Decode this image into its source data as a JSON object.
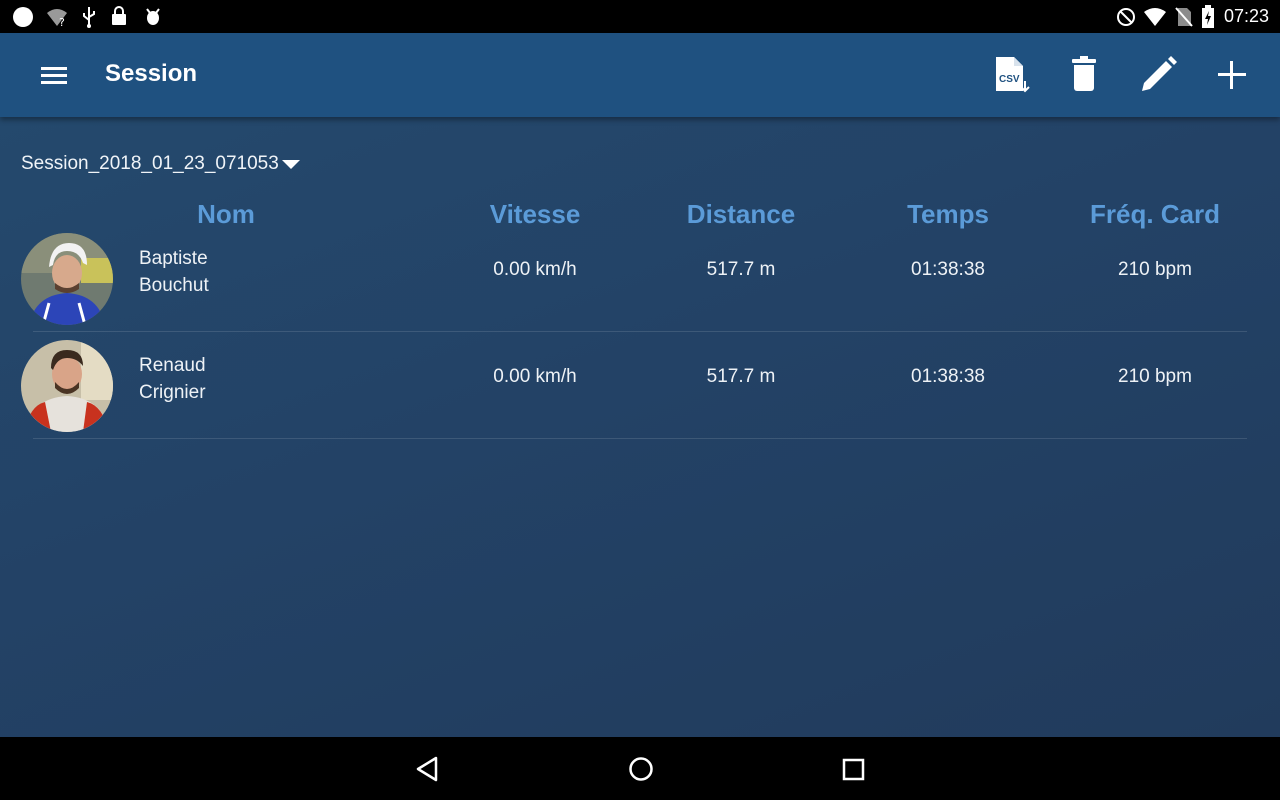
{
  "status_bar": {
    "time": "07:23",
    "left_icons": [
      "circle-icon",
      "wifi-unknown-icon",
      "usb-icon",
      "lock-icon",
      "android-debug-icon"
    ],
    "right_icons": [
      "do-not-disturb-icon",
      "wifi-icon",
      "no-sim-icon",
      "battery-charging-icon"
    ]
  },
  "app_bar": {
    "title": "Session",
    "actions": {
      "export_csv": "CSV",
      "delete": "delete-icon",
      "edit": "pencil-icon",
      "add": "plus-icon"
    }
  },
  "session_selector": {
    "value": "Session_2018_01_23_071053"
  },
  "table": {
    "headers": {
      "name": "Nom",
      "speed": "Vitesse",
      "distance": "Distance",
      "time": "Temps",
      "heart_rate": "Fréq. Card"
    },
    "rows": [
      {
        "first_name": "Baptiste",
        "last_name": "Bouchut",
        "speed": "0.00 km/h",
        "distance": "517.7 m",
        "time": "01:38:38",
        "heart_rate": "210 bpm"
      },
      {
        "first_name": "Renaud",
        "last_name": "Crignier",
        "speed": "0.00 km/h",
        "distance": "517.7 m",
        "time": "01:38:38",
        "heart_rate": "210 bpm"
      }
    ]
  },
  "colors": {
    "app_bar": "#1f5180",
    "header_text": "#5b9bd8",
    "background": "#234266"
  }
}
